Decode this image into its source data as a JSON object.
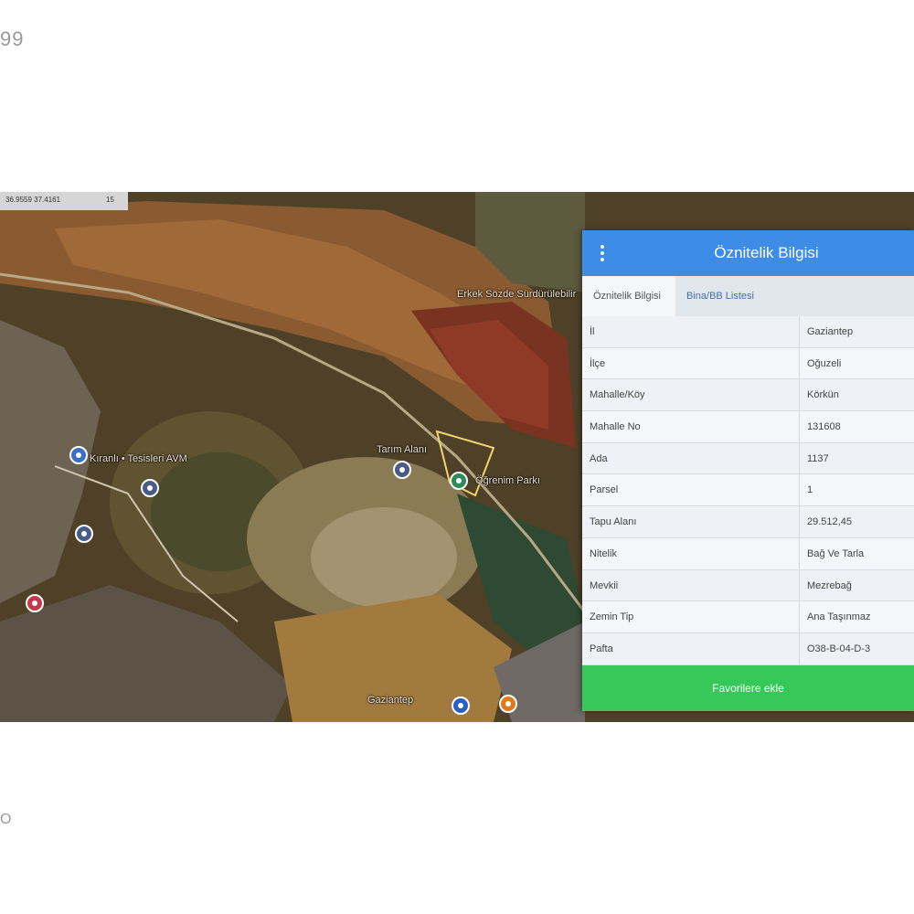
{
  "page": {
    "corner_text": "99",
    "corner_logo": "O"
  },
  "map": {
    "coord_bar": {
      "coords": "36.9559  37.4161",
      "zoom": "15"
    },
    "labels": [
      {
        "text": "Erkek Sözde Sürdürülebilir"
      },
      {
        "text": "Kıranlı • Tesisleri AVM"
      },
      {
        "text": "Tarım Alanı"
      },
      {
        "text": "Öğrenim Parkı"
      },
      {
        "text": "Gaziantep"
      }
    ],
    "pois": [
      {
        "name": "school-poi",
        "color": "#3a6fc9"
      },
      {
        "name": "mosque-poi",
        "color": "#4a5b85"
      },
      {
        "name": "building-poi",
        "color": "#4a5b85"
      },
      {
        "name": "hospital-poi",
        "color": "#c23a4b"
      },
      {
        "name": "parcel-poi",
        "color": "#4a5b85"
      },
      {
        "name": "park-poi",
        "color": "#2e8b57"
      },
      {
        "name": "bus-poi",
        "color": "#2b5fc7"
      },
      {
        "name": "food-poi",
        "color": "#e07a1f"
      }
    ]
  },
  "panel": {
    "title": "Öznitelik Bilgisi",
    "menu_icon": "vertical-dots-icon",
    "tabs": [
      {
        "label": "Öznitelik Bilgisi",
        "active": true
      },
      {
        "label": "Bina/BB Listesi",
        "active": false
      }
    ],
    "rows": [
      {
        "key": "İl",
        "value": "Gaziantep"
      },
      {
        "key": "İlçe",
        "value": "Oğuzeli"
      },
      {
        "key": "Mahalle/Köy",
        "value": "Körkün"
      },
      {
        "key": "Mahalle No",
        "value": "131608"
      },
      {
        "key": "Ada",
        "value": "1137"
      },
      {
        "key": "Parsel",
        "value": "1"
      },
      {
        "key": "Tapu Alanı",
        "value": "29.512,45"
      },
      {
        "key": "Nitelik",
        "value": "Bağ Ve Tarla"
      },
      {
        "key": "Mevkii",
        "value": "Mezrebağ"
      },
      {
        "key": "Zemin Tip",
        "value": "Ana Taşınmaz"
      },
      {
        "key": "Pafta",
        "value": "O38-B-04-D-3"
      }
    ],
    "favorite_button": "Favorilere ekle",
    "colors": {
      "header": "#3d8de6",
      "button": "#36c95a"
    }
  }
}
